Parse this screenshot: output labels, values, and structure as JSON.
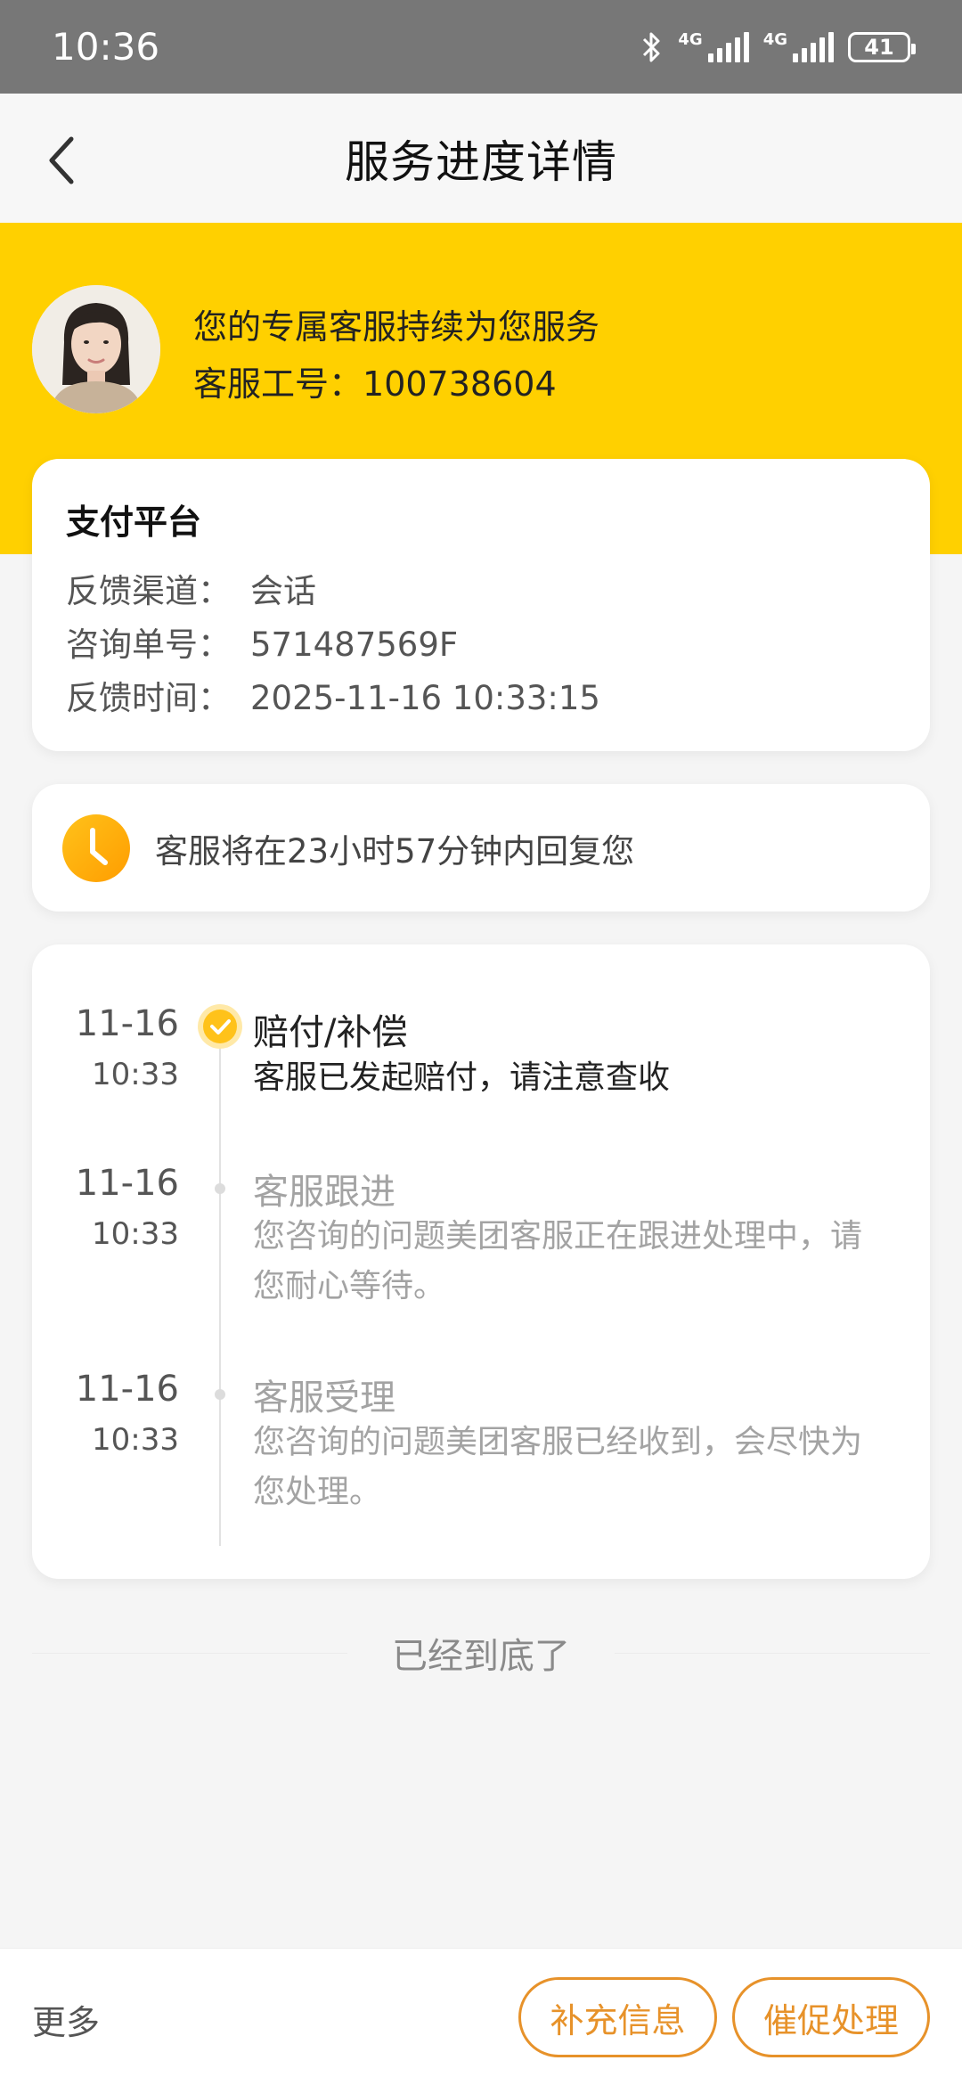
{
  "status_bar": {
    "time": "10:36",
    "network1": "4G",
    "network2": "4G",
    "battery": "41"
  },
  "nav": {
    "title": "服务进度详情"
  },
  "agent": {
    "headline": "您的专属客服持续为您服务",
    "id_label": "客服工号",
    "id_value": "100738604"
  },
  "ticket": {
    "title": "支付平台",
    "rows": [
      {
        "label": "反馈渠道",
        "value": "会话"
      },
      {
        "label": "咨询单号",
        "value": "571487569F"
      },
      {
        "label": "反馈时间",
        "value": "2025-11-16 10:33:15"
      }
    ]
  },
  "reply_notice": "客服将在23小时57分钟内回复您",
  "timeline": [
    {
      "date": "11-16",
      "time": "10:33",
      "title": "赔付/补偿",
      "desc": "客服已发起赔付，请注意查收",
      "state": "done"
    },
    {
      "date": "11-16",
      "time": "10:33",
      "title": "客服跟进",
      "desc": "您咨询的问题美团客服正在跟进处理中，请您耐心等待。",
      "state": "past"
    },
    {
      "date": "11-16",
      "time": "10:33",
      "title": "客服受理",
      "desc": "您咨询的问题美团客服已经收到，会尽快为您处理。",
      "state": "past"
    }
  ],
  "end_label": "已经到底了",
  "bottom": {
    "more": "更多",
    "supplement": "补充信息",
    "urge": "催促处理"
  },
  "colors": {
    "brand_yellow": "#ffd000",
    "accent_orange": "#e7922a",
    "status_bar": "#777777"
  }
}
